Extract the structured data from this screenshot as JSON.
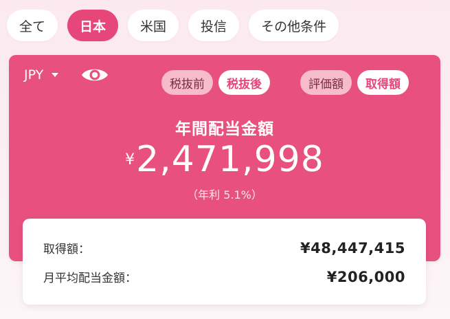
{
  "tabs": [
    {
      "label": "全て",
      "active": false
    },
    {
      "label": "日本",
      "active": true
    },
    {
      "label": "米国",
      "active": false
    },
    {
      "label": "投信",
      "active": false
    },
    {
      "label": "その他条件",
      "active": false
    }
  ],
  "card": {
    "currency": "JPY",
    "tax_toggle": {
      "before": "税抜前",
      "after": "税抜後",
      "selected": "after"
    },
    "value_toggle": {
      "valuation": "評価額",
      "acquisition": "取得額",
      "selected": "acquisition"
    },
    "title": "年間配当金額",
    "yen_symbol": "¥",
    "amount": "2,471,998",
    "yield_text": "（年利 5.1%）"
  },
  "summary": {
    "rows": [
      {
        "label": "取得額：",
        "value": "¥48,447,415"
      },
      {
        "label": "月平均配当金額：",
        "value": "¥206,000"
      }
    ]
  },
  "colors": {
    "accent": "#e7467b",
    "card": "#e8517f",
    "pill_off": "#f6bccd"
  },
  "icons": {
    "eye": "eye-icon",
    "dropdown": "chevron-down-icon"
  }
}
